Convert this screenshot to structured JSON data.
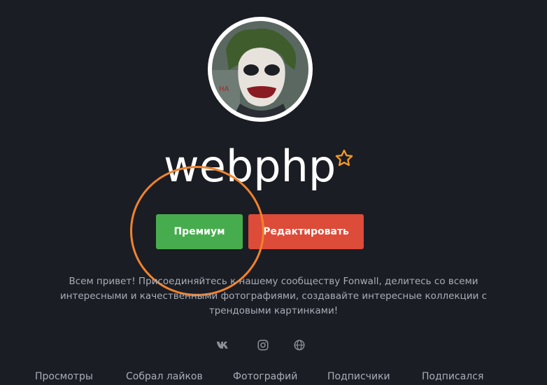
{
  "profile": {
    "username": "webphp",
    "bio": "Всем привет! Присоединяйтесь к нашему сообществу Fonwall, делитесь со всеми интересными и качественными фотографиями, создавайте интересные коллекции с трендовыми картинками!"
  },
  "buttons": {
    "premium_label": "Премиум",
    "edit_label": "Редактировать"
  },
  "social": [
    "vk-icon",
    "instagram-icon",
    "globe-icon"
  ],
  "stats": {
    "views": "Просмотры",
    "likes": "Собрал лайков",
    "photos": "Фотографий",
    "subscribers": "Подписчики",
    "subscribed": "Подписался"
  },
  "colors": {
    "background": "#1b1d24",
    "premium": "#47ac4d",
    "edit": "#dd4b39",
    "star": "#f59a23",
    "highlight": "#f0832e"
  }
}
